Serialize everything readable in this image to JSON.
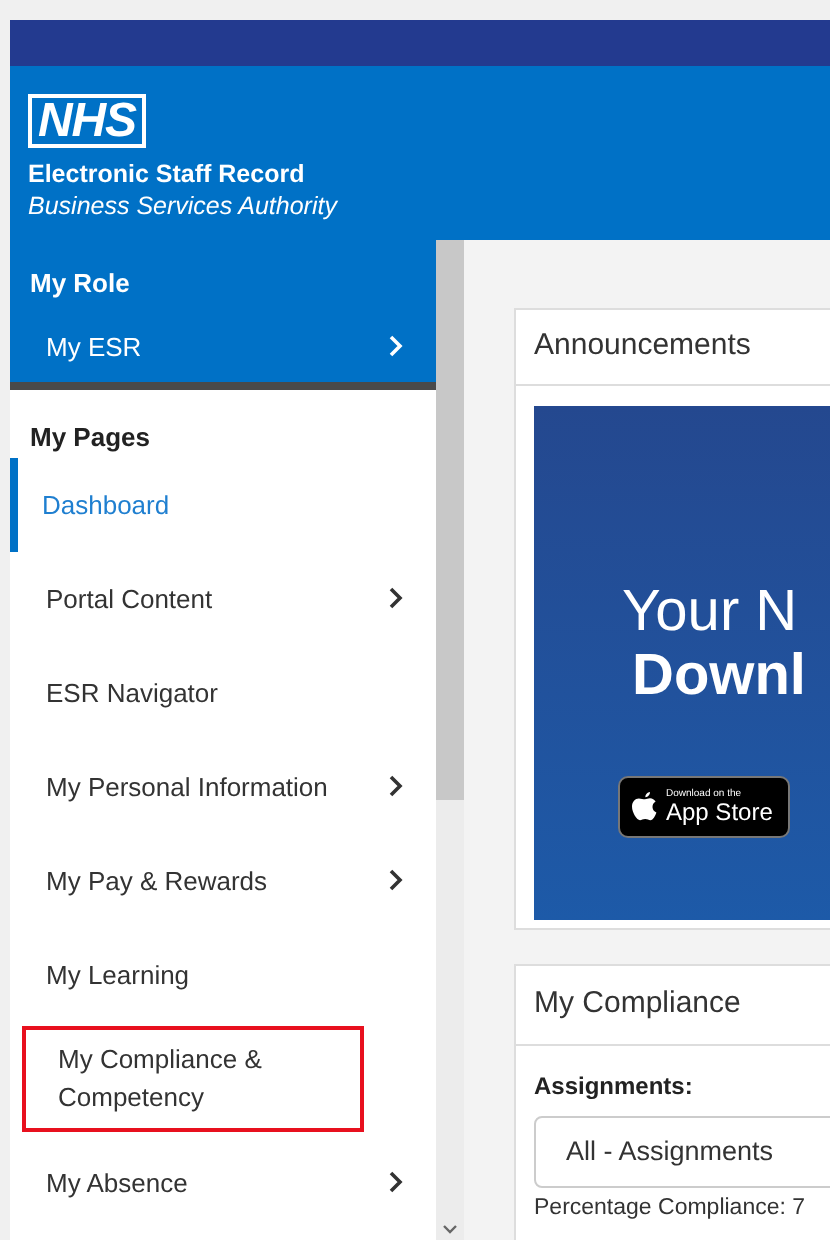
{
  "header": {
    "logo": "NHS",
    "title": "Electronic Staff Record",
    "subtitle": "Business Services Authority"
  },
  "sidebar": {
    "role_heading": "My Role",
    "role_item": {
      "label": "My ESR",
      "has_submenu": true
    },
    "pages_heading": "My Pages",
    "items": [
      {
        "label": "Dashboard",
        "selected": true,
        "has_submenu": false,
        "highlighted": false
      },
      {
        "label": "Portal Content",
        "selected": false,
        "has_submenu": true,
        "highlighted": false
      },
      {
        "label": "ESR Navigator",
        "selected": false,
        "has_submenu": false,
        "highlighted": false
      },
      {
        "label": "My Personal Information",
        "selected": false,
        "has_submenu": true,
        "highlighted": false
      },
      {
        "label": "My Pay & Rewards",
        "selected": false,
        "has_submenu": true,
        "highlighted": false
      },
      {
        "label": "My Learning",
        "selected": false,
        "has_submenu": false,
        "highlighted": false
      },
      {
        "label": "My Compliance & Competency",
        "selected": false,
        "has_submenu": false,
        "highlighted": true
      },
      {
        "label": "My Absence",
        "selected": false,
        "has_submenu": true,
        "highlighted": false
      }
    ]
  },
  "announcements": {
    "title": "Announcements",
    "banner": {
      "line_1": "Your N",
      "line_2": "Downl",
      "badge_small": "Download on the",
      "badge_large": "App Store"
    }
  },
  "compliance": {
    "title": "My Compliance",
    "assignments_label": "Assignments:",
    "assignments_value": "All - Assignments",
    "percentage": "Percentage Compliance: 7"
  }
}
